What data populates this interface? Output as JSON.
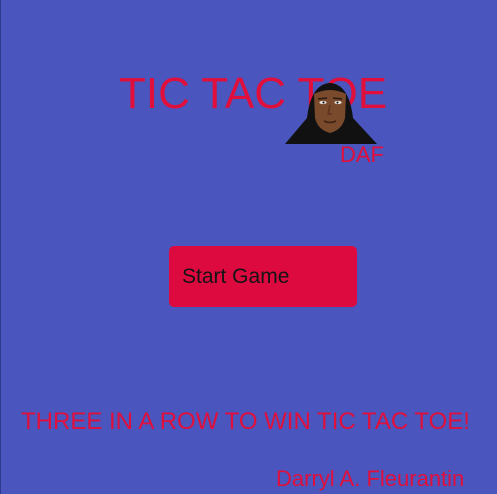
{
  "colors": {
    "background": "#4a55bd",
    "accent_text": "#e00f3c",
    "button_bg": "#dd0a40",
    "button_text": "#141414"
  },
  "title": "TIC TAC TOE",
  "author_initials": "DAF",
  "avatar_icon": "hooded-face-avatar-icon",
  "start_button_label": "Start Game",
  "tagline": "THREE IN A ROW TO WIN TIC TAC TOE!",
  "author_credit": "Darryl A. Fleurantin"
}
